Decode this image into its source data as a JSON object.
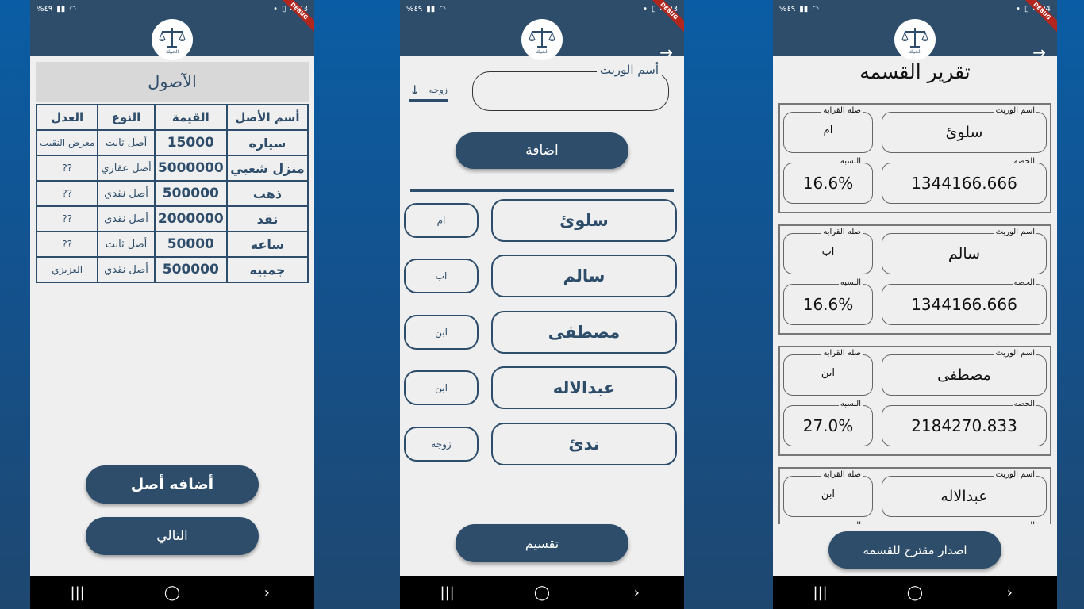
{
  "status": {
    "left1": "%٤٩",
    "left2": "%٤٩",
    "left3": "%٤٩",
    "time1": "4:03",
    "time2": "4:03",
    "time3": "4:04",
    "debug": "DEBUG"
  },
  "logo_text": "الحبيك",
  "screen1": {
    "title": "الآصول",
    "headers": [
      "أسم الأصل",
      "القيمة",
      "النوع",
      "العدل"
    ],
    "rows": [
      {
        "name": "سياره",
        "value": "15000",
        "type": "أصل ثابت",
        "just": "معرض النقيب"
      },
      {
        "name": "منزل شعبي",
        "value": "5000000",
        "type": "أصل عقاري",
        "just": "??"
      },
      {
        "name": "ذهب",
        "value": "500000",
        "type": "أصل نقدي",
        "just": "??"
      },
      {
        "name": "نقد",
        "value": "2000000",
        "type": "أصل نقدي",
        "just": "??"
      },
      {
        "name": "ساعه",
        "value": "50000",
        "type": "أصل ثابت",
        "just": "??"
      },
      {
        "name": "جمبيه",
        "value": "500000",
        "type": "أصل نقدي",
        "just": "العزيزي"
      }
    ],
    "add_button": "أضافه أصل",
    "next_button": "التالي"
  },
  "screen2": {
    "heir_label": "أسم الوريث",
    "heir_value": "",
    "relation_selected": "زوجه",
    "add_button": "اضافة",
    "heirs": [
      {
        "name": "سلوئ",
        "relation": "ام"
      },
      {
        "name": "سالم",
        "relation": "اب"
      },
      {
        "name": "مصطفى",
        "relation": "ابن"
      },
      {
        "name": "عبدالاله",
        "relation": "ابن"
      },
      {
        "name": "ندئ",
        "relation": "زوجه"
      }
    ],
    "divide_button": "تقسيم"
  },
  "screen3": {
    "title": "تقرير القسمه",
    "labels": {
      "name": "اسم الوريث",
      "relation": "صله القرابه",
      "share": "الحصه",
      "ratio": "النسبه"
    },
    "cards": [
      {
        "name": "سلوئ",
        "relation": "ام",
        "share": "1344166.666",
        "ratio": "16.6%"
      },
      {
        "name": "سالم",
        "relation": "اب",
        "share": "1344166.666",
        "ratio": "16.6%"
      },
      {
        "name": "مصطفى",
        "relation": "ابن",
        "share": "2184270.833",
        "ratio": "27.0%"
      },
      {
        "name": "عبدالاله",
        "relation": "ابن",
        "share": "",
        "ratio": ""
      }
    ],
    "issue_button": "اصدار مقترح للقسمه"
  }
}
